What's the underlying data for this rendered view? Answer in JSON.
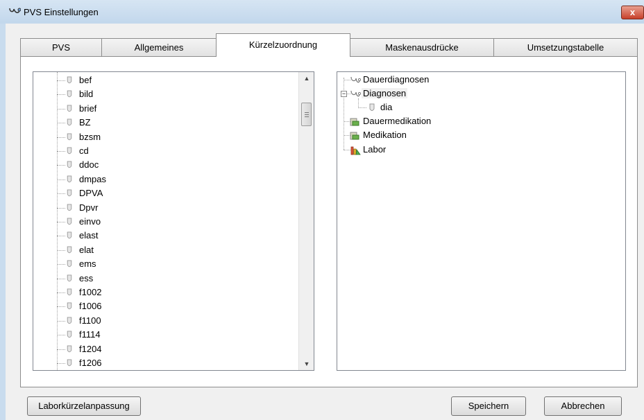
{
  "window": {
    "title": "PVS Einstellungen",
    "close_label": "x"
  },
  "tabs": [
    {
      "label": "PVS",
      "active": false
    },
    {
      "label": "Allgemeines",
      "active": false
    },
    {
      "label": "Kürzelzuordnung",
      "active": true
    },
    {
      "label": "Maskenausdrücke",
      "active": false
    },
    {
      "label": "Umsetzungstabelle",
      "active": false
    }
  ],
  "left_list": {
    "items": [
      "bef",
      "bild",
      "brief",
      "BZ",
      "bzsm",
      "cd",
      "ddoc",
      "dmpas",
      "DPVA",
      "Dpvr",
      "einvo",
      "elast",
      "elat",
      "ems",
      "ess",
      "f1002",
      "f1006",
      "f1100",
      "f1114",
      "f1204",
      "f1206"
    ]
  },
  "right_tree": {
    "nodes": [
      {
        "label": "Dauerdiagnosen",
        "icon": "stethoscope-icon"
      },
      {
        "label": "Diagnosen",
        "icon": "stethoscope-icon",
        "expanded": true,
        "expander": "−"
      },
      {
        "label": "dia",
        "icon": "pin-icon",
        "child": true
      },
      {
        "label": "Dauermedikation",
        "icon": "medication-icon"
      },
      {
        "label": "Medikation",
        "icon": "medication-icon"
      },
      {
        "label": "Labor",
        "icon": "lab-flask-icon"
      }
    ]
  },
  "buttons": {
    "labor": "Laborkürzelanpassung",
    "save": "Speichern",
    "cancel": "Abbrechen"
  },
  "colors": {
    "titlebar": "#c9dcee",
    "close": "#c8402a",
    "panel": "#ffffff",
    "background": "#f0f0f0"
  }
}
